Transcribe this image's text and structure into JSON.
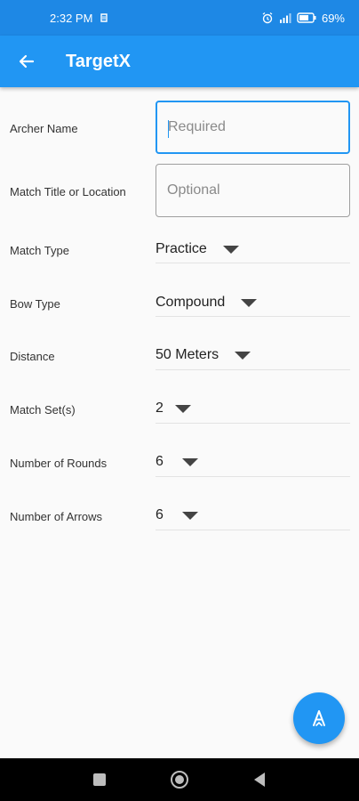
{
  "status_bar": {
    "time": "2:32 PM",
    "battery": "69"
  },
  "app_bar": {
    "title": "TargetX"
  },
  "form": {
    "archer_name": {
      "label": "Archer Name",
      "value": "",
      "placeholder": "Required"
    },
    "match_title": {
      "label": "Match Title or Location",
      "value": "",
      "placeholder": "Optional"
    },
    "match_type": {
      "label": "Match Type",
      "value": "Practice"
    },
    "bow_type": {
      "label": "Bow Type",
      "value": "Compound"
    },
    "distance": {
      "label": "Distance",
      "value": "50 Meters"
    },
    "match_sets": {
      "label": "Match Set(s)",
      "value": "2"
    },
    "rounds": {
      "label": "Number of Rounds",
      "value": "6"
    },
    "arrows": {
      "label": "Number of Arrows",
      "value": "6"
    }
  },
  "colors": {
    "primary": "#2196f3",
    "status_bar": "#1e88e5",
    "nav_bar": "#000000"
  },
  "icons": [
    "back-arrow-icon",
    "fab-archer-icon",
    "recents-square-icon",
    "home-circle-icon",
    "back-triangle-icon"
  ]
}
